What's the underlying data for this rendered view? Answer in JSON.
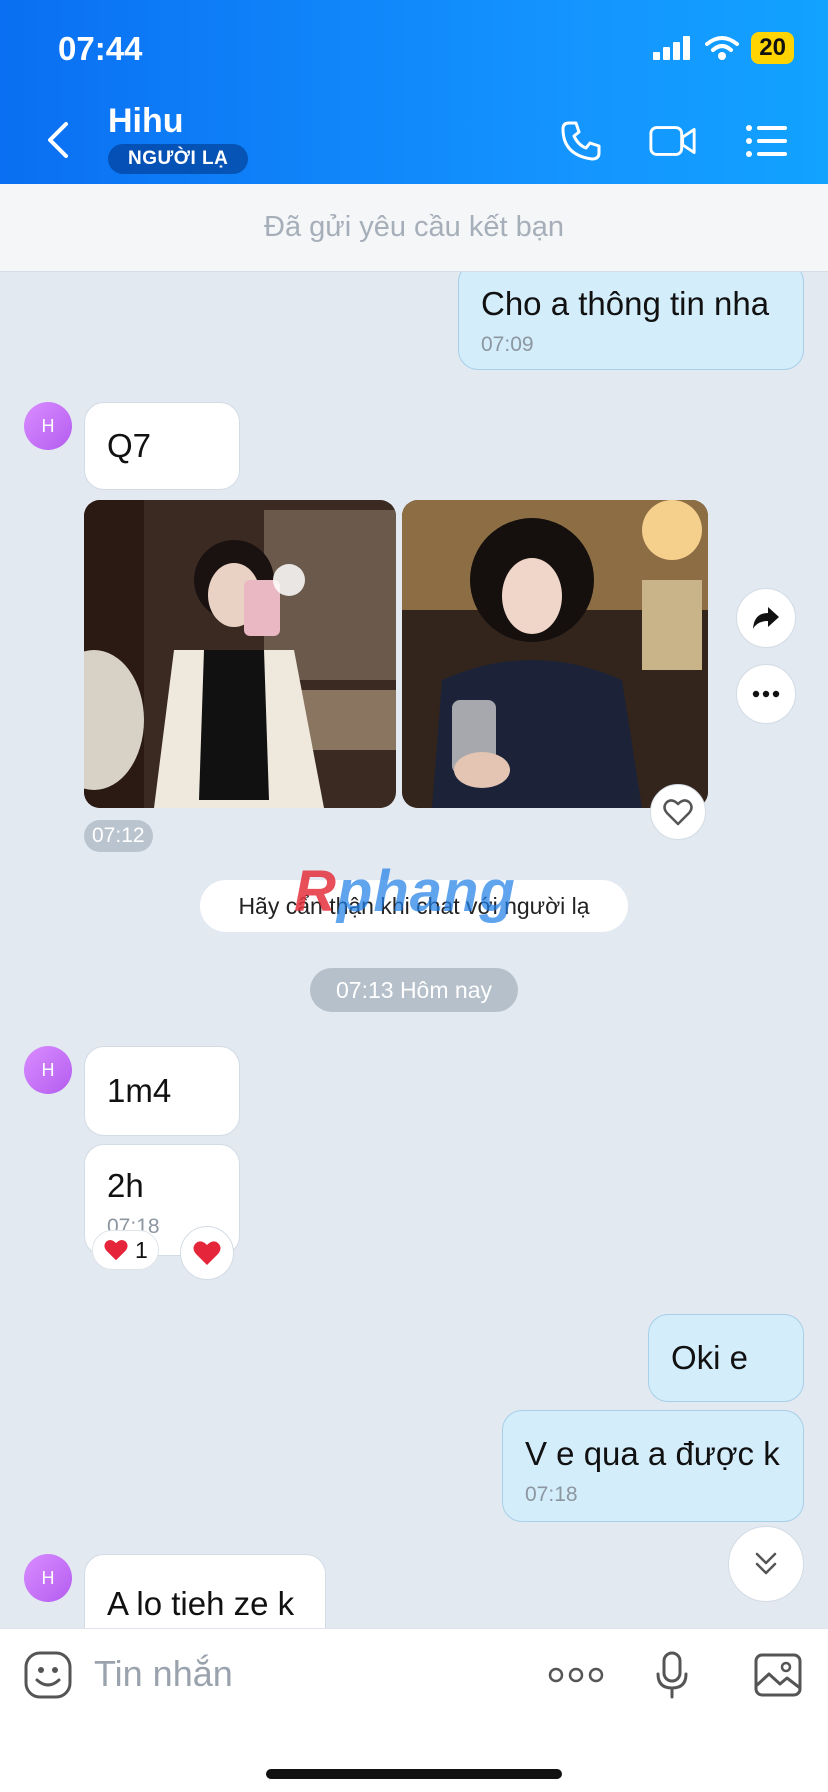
{
  "status": {
    "time": "07:44",
    "battery": "20"
  },
  "header": {
    "title": "Hihu",
    "badge": "NGƯỜI LẠ"
  },
  "request_bar": {
    "text": "Đã gửi yêu cầu kết bạn"
  },
  "messages": {
    "m1": {
      "text": "Cho a thông tin nha",
      "time": "07:09"
    },
    "m2": {
      "text": "Q7"
    },
    "photos_time": "07:12",
    "m3": {
      "text": "1m4"
    },
    "m4": {
      "text": "2h",
      "time": "07:18"
    },
    "m4_reaction_count": "1",
    "m5": {
      "text": "Oki e"
    },
    "m6": {
      "text": "V e qua a được k",
      "time": "07:18"
    },
    "m7": {
      "text": "A lo tieh ze k"
    }
  },
  "avatar_initial": "H",
  "warning": "Hãy cẩn thận khi chat với người lạ",
  "watermark": {
    "part1": "R",
    "part2": "phang"
  },
  "date_divider": "07:13 Hôm nay",
  "input": {
    "placeholder": "Tin nhắn"
  },
  "colors": {
    "header": "#0a6ff2",
    "outgoing_bubble": "#d4edfb",
    "background": "#e2e9f1"
  },
  "icons": [
    "back-icon",
    "phone-icon",
    "video-icon",
    "menu-icon",
    "share-icon",
    "more-icon",
    "heart-icon",
    "scroll-down-icon",
    "sticker-icon",
    "ellipsis-icon",
    "mic-icon",
    "image-icon"
  ]
}
